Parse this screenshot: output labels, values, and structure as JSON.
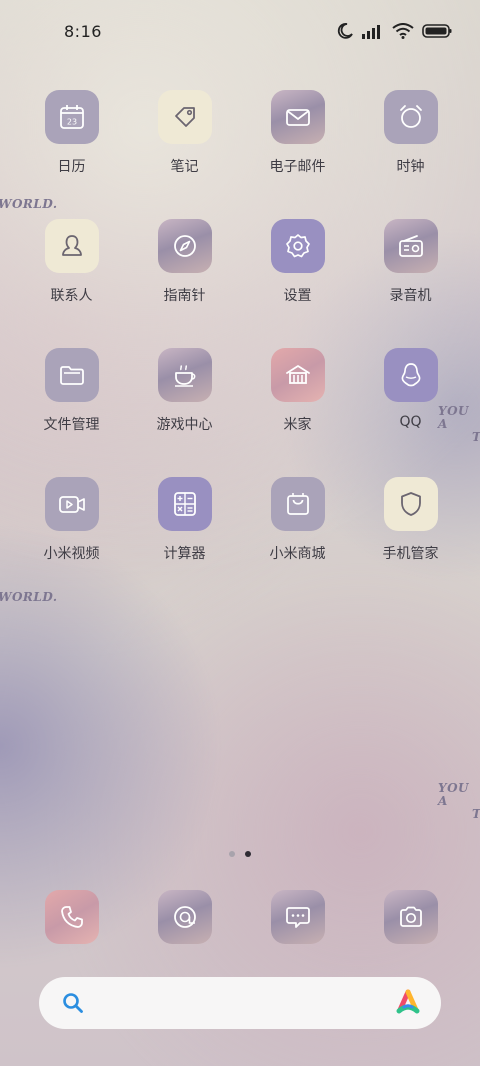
{
  "status_bar": {
    "time": "8:16",
    "icons": [
      "moon-icon",
      "signal-icon",
      "wifi-icon",
      "battery-icon"
    ]
  },
  "watermarks": {
    "world_1": "WORLD.",
    "world_2": "WORLD.",
    "you_1_line1": "YOU A",
    "you_1_line2": "T",
    "you_2_line1": "YOU A",
    "you_2_line2": "T"
  },
  "apps": [
    {
      "label": "日历",
      "icon": "calendar-icon",
      "day": "23"
    },
    {
      "label": "笔记",
      "icon": "tag-icon"
    },
    {
      "label": "电子邮件",
      "icon": "mail-icon"
    },
    {
      "label": "时钟",
      "icon": "alarm-clock-icon"
    },
    {
      "label": "联系人",
      "icon": "person-icon"
    },
    {
      "label": "指南针",
      "icon": "compass-icon"
    },
    {
      "label": "设置",
      "icon": "gear-icon"
    },
    {
      "label": "录音机",
      "icon": "radio-icon"
    },
    {
      "label": "文件管理",
      "icon": "folder-icon"
    },
    {
      "label": "游戏中心",
      "icon": "cup-icon"
    },
    {
      "label": "米家",
      "icon": "home-icon"
    },
    {
      "label": "QQ",
      "icon": "penguin-icon"
    },
    {
      "label": "小米视频",
      "icon": "video-icon"
    },
    {
      "label": "计算器",
      "icon": "calculator-icon"
    },
    {
      "label": "小米商城",
      "icon": "shopping-bag-icon"
    },
    {
      "label": "手机管家",
      "icon": "shield-icon"
    }
  ],
  "page_indicator": {
    "count": 2,
    "active": 2
  },
  "dock": [
    {
      "icon": "phone-icon"
    },
    {
      "icon": "browser-icon"
    },
    {
      "icon": "message-icon"
    },
    {
      "icon": "camera-icon"
    }
  ],
  "search_bar": {
    "icons": [
      "search-icon",
      "assistant-icon"
    ]
  },
  "colors": {
    "grey_tile": "#aaa3b9",
    "cream_tile": "#efe9d5",
    "purple_tile": "#9990c1",
    "label_text": "#3f3d45",
    "search_blue": "#2b8ee0"
  }
}
